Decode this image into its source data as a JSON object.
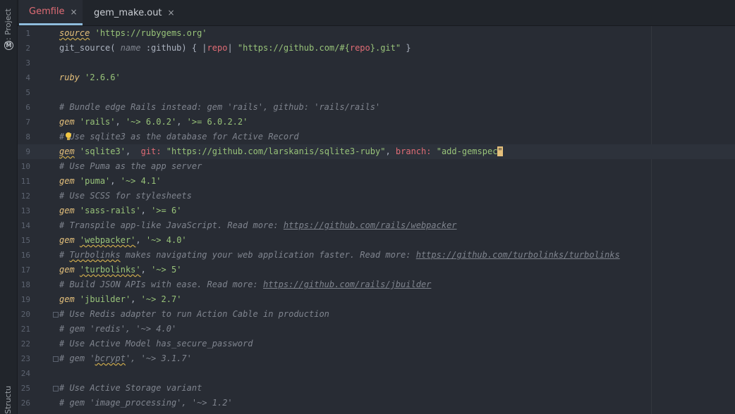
{
  "sidebar": {
    "project_label": "1: Project",
    "structure_label": "Structure",
    "maven_icon": "M"
  },
  "tabs": [
    {
      "label": "Gemfile",
      "icon": "ruby-gem-icon",
      "active": true,
      "close": "×"
    },
    {
      "label": "gem_make.out",
      "icon": "file-icon",
      "active": false,
      "close": "×"
    }
  ],
  "editor": {
    "lines": [
      {
        "n": "1",
        "segs": [
          {
            "t": "source",
            "c": "kw squig"
          },
          {
            "t": " ",
            "c": "sym"
          },
          {
            "t": "'https://rubygems.org'",
            "c": "str"
          }
        ]
      },
      {
        "n": "2",
        "segs": [
          {
            "t": "git_source( ",
            "c": "sym"
          },
          {
            "t": "name",
            "c": "cmt"
          },
          {
            "t": " :github) { |",
            "c": "sym"
          },
          {
            "t": "repo",
            "c": "var"
          },
          {
            "t": "| ",
            "c": "sym"
          },
          {
            "t": "\"https://github.com/#{",
            "c": "str"
          },
          {
            "t": "repo",
            "c": "var"
          },
          {
            "t": "}.git\"",
            "c": "str"
          },
          {
            "t": " }",
            "c": "sym"
          }
        ]
      },
      {
        "n": "3",
        "segs": []
      },
      {
        "n": "4",
        "segs": [
          {
            "t": "ruby",
            "c": "kw"
          },
          {
            "t": " ",
            "c": "sym"
          },
          {
            "t": "'2.6.6'",
            "c": "str"
          }
        ]
      },
      {
        "n": "5",
        "segs": []
      },
      {
        "n": "6",
        "segs": [
          {
            "t": "# Bundle edge Rails instead: gem 'rails', github: 'rails/rails'",
            "c": "cmt"
          }
        ]
      },
      {
        "n": "7",
        "segs": [
          {
            "t": "gem",
            "c": "kw"
          },
          {
            "t": " ",
            "c": "sym"
          },
          {
            "t": "'rails'",
            "c": "str"
          },
          {
            "t": ", ",
            "c": "sym"
          },
          {
            "t": "'~> 6.0.2'",
            "c": "str"
          },
          {
            "t": ", ",
            "c": "sym"
          },
          {
            "t": "'>= 6.0.2.2'",
            "c": "str"
          }
        ]
      },
      {
        "n": "8",
        "segs": [
          {
            "t": "# Use sqlite3 as the database for Active Record",
            "c": "cmt"
          }
        ]
      },
      {
        "n": "9",
        "current": true,
        "segs": [
          {
            "t": "gem",
            "c": "kw squig"
          },
          {
            "t": " ",
            "c": "sym"
          },
          {
            "t": "'sqlite3'",
            "c": "str"
          },
          {
            "t": ",  ",
            "c": "sym"
          },
          {
            "t": "git:",
            "c": "var"
          },
          {
            "t": " ",
            "c": "sym"
          },
          {
            "t": "\"https://github.com/larskanis/sqlite3-ruby\"",
            "c": "str"
          },
          {
            "t": ", ",
            "c": "sym"
          },
          {
            "t": "branch:",
            "c": "var"
          },
          {
            "t": " ",
            "c": "sym"
          },
          {
            "t": "\"add-gemspec",
            "c": "str"
          },
          {
            "t": "\"",
            "c": "caret"
          }
        ]
      },
      {
        "n": "10",
        "segs": [
          {
            "t": "# Use Puma as the app server",
            "c": "cmt"
          }
        ]
      },
      {
        "n": "11",
        "segs": [
          {
            "t": "gem",
            "c": "kw"
          },
          {
            "t": " ",
            "c": "sym"
          },
          {
            "t": "'puma'",
            "c": "str"
          },
          {
            "t": ", ",
            "c": "sym"
          },
          {
            "t": "'~> 4.1'",
            "c": "str"
          }
        ]
      },
      {
        "n": "12",
        "segs": [
          {
            "t": "# Use SCSS for stylesheets",
            "c": "cmt"
          }
        ]
      },
      {
        "n": "13",
        "segs": [
          {
            "t": "gem",
            "c": "kw"
          },
          {
            "t": " ",
            "c": "sym"
          },
          {
            "t": "'sass-rails'",
            "c": "str"
          },
          {
            "t": ", ",
            "c": "sym"
          },
          {
            "t": "'>= 6'",
            "c": "str"
          }
        ]
      },
      {
        "n": "14",
        "segs": [
          {
            "t": "# Transpile app-like JavaScript. Read more: ",
            "c": "cmt"
          },
          {
            "t": "https://github.com/rails/webpacker",
            "c": "cmt link"
          }
        ]
      },
      {
        "n": "15",
        "segs": [
          {
            "t": "gem",
            "c": "kw"
          },
          {
            "t": " ",
            "c": "sym"
          },
          {
            "t": "'webpacker'",
            "c": "str squig"
          },
          {
            "t": ", ",
            "c": "sym"
          },
          {
            "t": "'~> 4.0'",
            "c": "str"
          }
        ]
      },
      {
        "n": "16",
        "segs": [
          {
            "t": "# ",
            "c": "cmt"
          },
          {
            "t": "Turbolinks",
            "c": "cmt squig"
          },
          {
            "t": " makes navigating your web application faster. Read more: ",
            "c": "cmt"
          },
          {
            "t": "https://github.com/turbolinks/turbolinks",
            "c": "cmt link"
          }
        ]
      },
      {
        "n": "17",
        "segs": [
          {
            "t": "gem",
            "c": "kw"
          },
          {
            "t": " ",
            "c": "sym"
          },
          {
            "t": "'turbolinks'",
            "c": "str squig"
          },
          {
            "t": ", ",
            "c": "sym"
          },
          {
            "t": "'~> 5'",
            "c": "str"
          }
        ]
      },
      {
        "n": "18",
        "segs": [
          {
            "t": "# Build JSON APIs with ease. Read more: ",
            "c": "cmt"
          },
          {
            "t": "https://github.com/rails/jbuilder",
            "c": "cmt link"
          }
        ]
      },
      {
        "n": "19",
        "segs": [
          {
            "t": "gem",
            "c": "kw"
          },
          {
            "t": " ",
            "c": "sym"
          },
          {
            "t": "'jbuilder'",
            "c": "str"
          },
          {
            "t": ", ",
            "c": "sym"
          },
          {
            "t": "'~> 2.7'",
            "c": "str"
          }
        ]
      },
      {
        "n": "20",
        "fold": true,
        "segs": [
          {
            "t": "# Use Redis adapter to run Action Cable in production",
            "c": "cmt"
          }
        ]
      },
      {
        "n": "21",
        "segs": [
          {
            "t": "# gem 'redis', '~> 4.0'",
            "c": "cmt"
          }
        ]
      },
      {
        "n": "22",
        "segs": [
          {
            "t": "# Use Active Model has_secure_password",
            "c": "cmt"
          }
        ]
      },
      {
        "n": "23",
        "fold": true,
        "segs": [
          {
            "t": "# gem '",
            "c": "cmt"
          },
          {
            "t": "bcrypt",
            "c": "cmt squig"
          },
          {
            "t": "', '~> 3.1.7'",
            "c": "cmt"
          }
        ]
      },
      {
        "n": "24",
        "segs": []
      },
      {
        "n": "25",
        "fold": true,
        "segs": [
          {
            "t": "# Use Active Storage variant",
            "c": "cmt"
          }
        ]
      },
      {
        "n": "26",
        "segs": [
          {
            "t": "# gem 'image_processing', '~> 1.2'",
            "c": "cmt"
          }
        ]
      }
    ]
  }
}
